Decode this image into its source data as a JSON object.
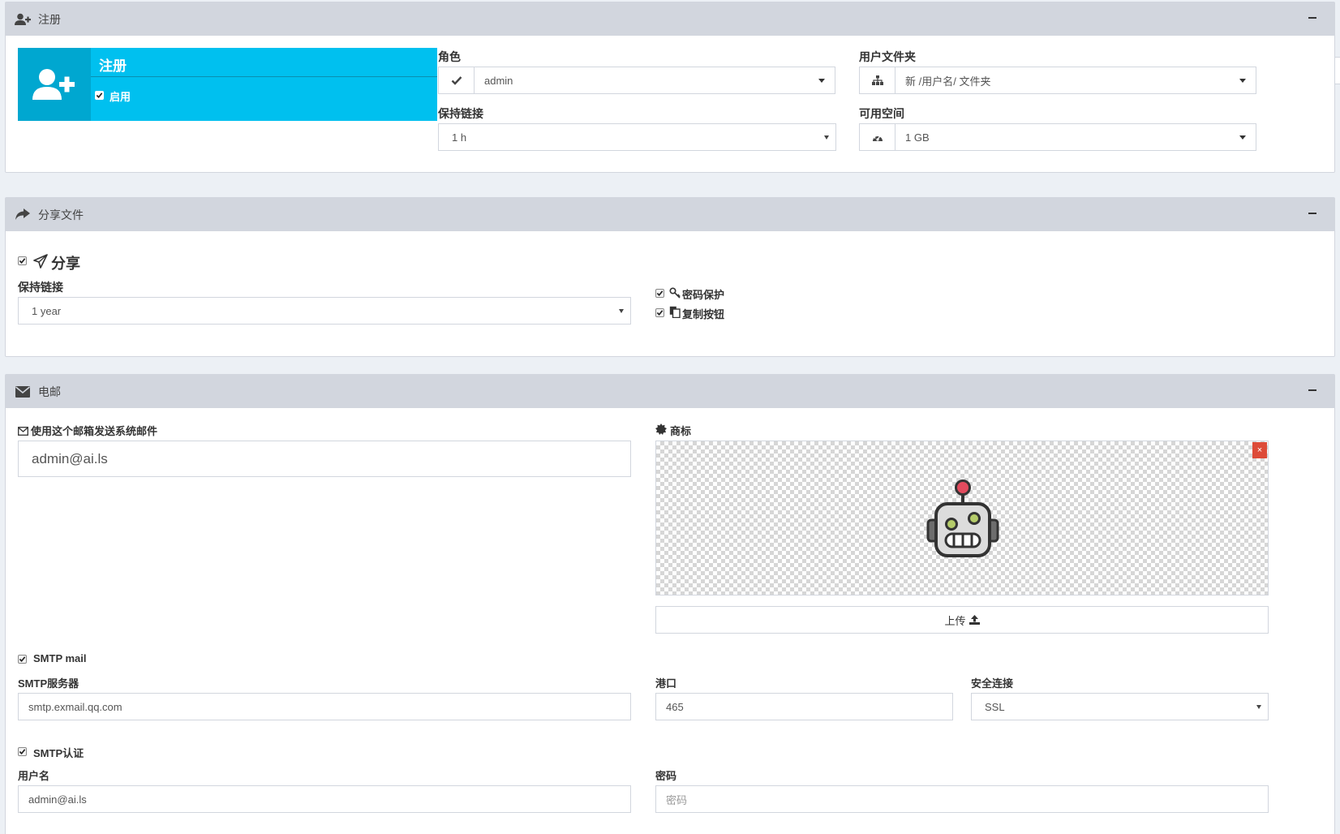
{
  "colors": {
    "accent": "#00c0ef",
    "accent_dark": "#00a7d0",
    "header_bg": "#d2d6de",
    "danger": "#dd4b39"
  },
  "register": {
    "header_title": "注册",
    "card_title": "注册",
    "enabled_label": "启用",
    "role_label": "角色",
    "role_value": "admin",
    "keep_link_label": "保持链接",
    "keep_link_value": "1 h",
    "user_folder_label": "用户文件夹",
    "user_folder_value": "新 /用户名/ 文件夹",
    "space_label": "可用空间",
    "space_value": "1 GB"
  },
  "share": {
    "header_title": "分享文件",
    "share_label": "分享",
    "keep_link_label": "保持链接",
    "keep_link_value": "1 year",
    "password_protect_label": "密码保护",
    "copy_button_label": "复制按钮"
  },
  "email": {
    "header_title": "电邮",
    "send_label": "使用这个邮箱发送系统邮件",
    "send_value": "admin@ai.ls",
    "logo_label": "商标",
    "delete_label": "×",
    "upload_label": "上传",
    "smtp_mail_label": "SMTP mail",
    "smtp_server_label": "SMTP服务器",
    "smtp_server_value": "smtp.exmail.qq.com",
    "port_label": "港口",
    "port_value": "465",
    "secure_label": "安全连接",
    "secure_value": "SSL",
    "smtp_auth_label": "SMTP认证",
    "username_label": "用户名",
    "username_value": "admin@ai.ls",
    "password_label": "密码",
    "password_placeholder": "密码"
  }
}
